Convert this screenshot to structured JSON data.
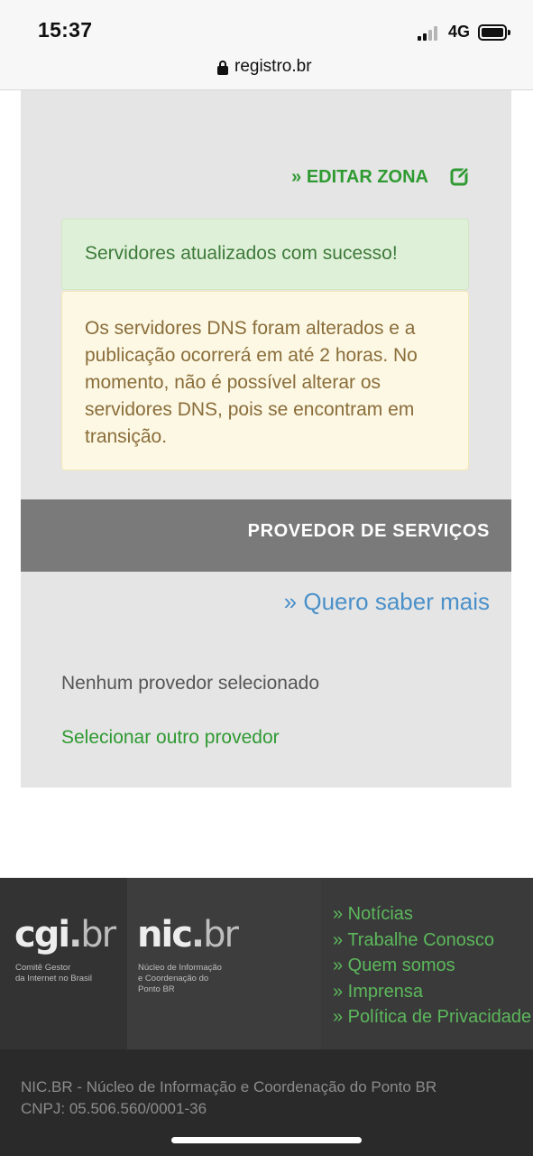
{
  "status_bar": {
    "time": "15:37",
    "network": "4G"
  },
  "url_bar": {
    "url": "registro.br"
  },
  "zone": {
    "edit_label": "» EDITAR ZONA"
  },
  "alerts": {
    "success": "Servidores atualizados com sucesso!",
    "warning": "Os servidores DNS foram alterados e a publicação ocorrerá em até 2 horas. No momento, não é possível alterar os servidores DNS, pois se encontram em transição."
  },
  "provider": {
    "title": "PROVEDOR DE SERVIÇOS",
    "learn_more": "» Quero saber mais",
    "none_selected": "Nenhum provedor selecionado",
    "select_other": "Selecionar outro provedor"
  },
  "footer": {
    "cgi_logo": {
      "name": "cgi",
      "dot": ".",
      "tld": "br",
      "subtitle_1": "Comitê Gestor",
      "subtitle_2": "da Internet no Brasil"
    },
    "nic_logo": {
      "name": "nic",
      "dot": ".",
      "tld": "br",
      "subtitle_1": "Núcleo de Informação",
      "subtitle_2": "e Coordenação do",
      "subtitle_3": "Ponto BR"
    },
    "links": [
      "» Notícias",
      "» Trabalhe Conosco",
      "» Quem somos",
      "» Imprensa",
      "» Política de Privacidade"
    ],
    "org_line": "NIC.BR - Núcleo de Informação e Coordenação do Ponto BR",
    "cnpj_line": "CNPJ: 05.506.560/0001-36"
  },
  "colors": {
    "accent_green": "#2f9a32",
    "link_blue": "#4a90c9",
    "success_bg": "#dff0d8",
    "warning_bg": "#fcf8e3",
    "header_gray": "#7a7a7a"
  }
}
